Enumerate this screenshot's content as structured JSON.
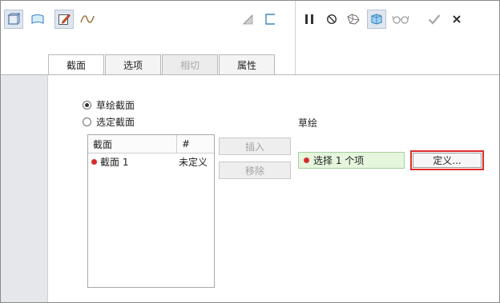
{
  "tabs": [
    {
      "label": "截面"
    },
    {
      "label": "选项"
    },
    {
      "label": "相切"
    },
    {
      "label": "属性"
    }
  ],
  "options": {
    "sketch_section": "草绘截面",
    "selected_section": "选定截面",
    "selected": "sketch_section"
  },
  "section_list": {
    "headers": {
      "name": "截面",
      "num": "#"
    },
    "rows": [
      {
        "name": "截面 1",
        "status": "未定义"
      }
    ]
  },
  "buttons": {
    "insert": "插入",
    "remove": "移除",
    "define": "定义..."
  },
  "sketch": {
    "label": "草绘",
    "collector": "选择 1 个项"
  },
  "colors": {
    "status_dot": "#d62c2c",
    "collector_bg": "#e5f6dd",
    "highlight_border": "#e02b2b"
  }
}
